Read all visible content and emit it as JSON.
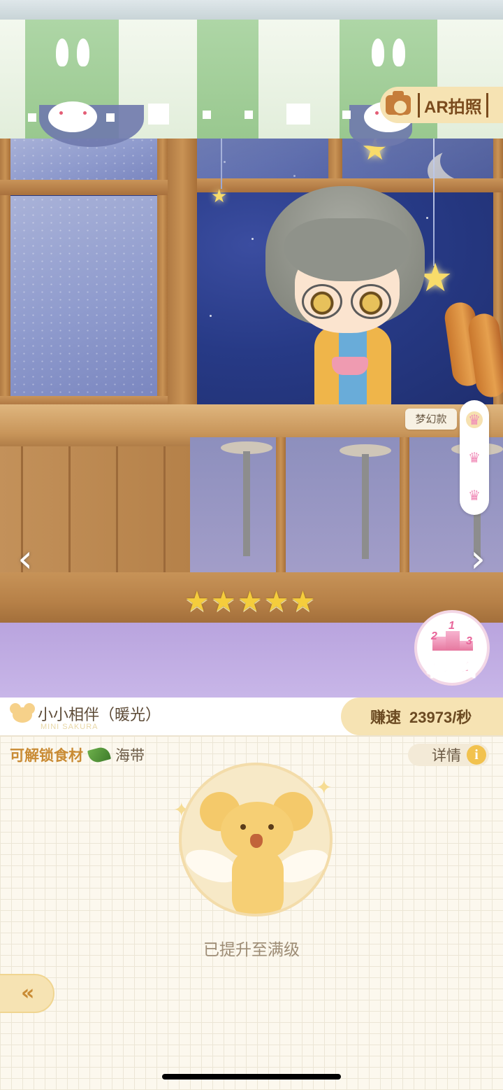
{
  "scene": {
    "ar_button_label": "AR拍照",
    "style_tag": "梦幻款",
    "rating_stars": 5,
    "rank_button_label": "看排名",
    "rank_podium_numbers": [
      "2",
      "1",
      "3"
    ],
    "nav": {
      "prev_icon": "‹",
      "next_icon": "›"
    }
  },
  "info": {
    "character_name": "小小相伴（暖光）",
    "character_subtitle": "MINI SAKURA",
    "speed_label": "赚速",
    "speed_value": "23973/秒",
    "unlock_label": "可解锁食材",
    "ingredient": "海带",
    "detail_label": "详情",
    "status_text": "已提升至满级"
  },
  "colors": {
    "accent_gold": "#f6e3b3",
    "brown_text": "#6b4a22",
    "pink": "#f07aa6",
    "star_yellow": "#f5cd3c"
  }
}
